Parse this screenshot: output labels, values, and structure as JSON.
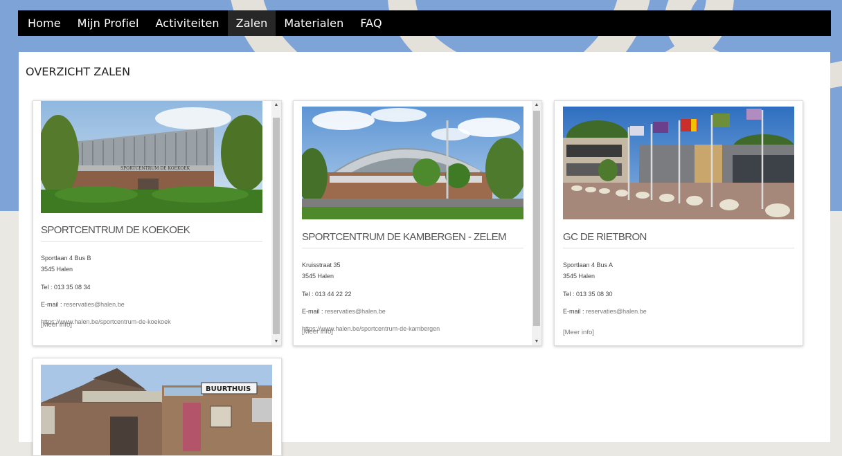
{
  "nav": {
    "items": [
      {
        "label": "Home",
        "active": false
      },
      {
        "label": "Mijn Profiel",
        "active": false
      },
      {
        "label": "Activiteiten",
        "active": false
      },
      {
        "label": "Zalen",
        "active": true
      },
      {
        "label": "Materialen",
        "active": false
      },
      {
        "label": "FAQ",
        "active": false
      }
    ]
  },
  "page": {
    "title": "OVERZICHT ZALEN"
  },
  "cards": [
    {
      "title": "SPORTCENTRUM DE KOEKOEK",
      "address1": "Sportlaan 4 Bus B",
      "address2": "3545 Halen",
      "tel": "Tel : 013 35 08 34",
      "email_label": "E-mail : ",
      "email": "reservaties@halen.be",
      "url": "https://www.halen.be/sportcentrum-de-koekoek",
      "more": "[Meer info]",
      "photo_sign": "SPORTCENTRUM DE KOEKOEK"
    },
    {
      "title": "SPORTCENTRUM DE KAMBERGEN - ZELEM",
      "address1": "Kruisstraat 35",
      "address2": "3545 Halen",
      "tel": "Tel : 013 44 22 22",
      "email_label": "E-mail : ",
      "email": "reservaties@halen.be",
      "url": "https://www.halen.be/sportcentrum-de-kambergen",
      "more": "[Meer info]"
    },
    {
      "title": "GC DE RIETBRON",
      "address1": "Sportlaan 4 Bus A",
      "address2": "3545 Halen",
      "tel": "Tel : 013 35 08 30",
      "email_label": "E-mail : ",
      "email": "reservaties@halen.be",
      "more": "[Meer info]"
    },
    {
      "photo_sign": "BUURTHUIS"
    }
  ],
  "colors": {
    "nav_bg": "#000000",
    "nav_active": "#272727",
    "header_bg": "#7ea3d6",
    "page_bg": "#e9e8e3"
  }
}
